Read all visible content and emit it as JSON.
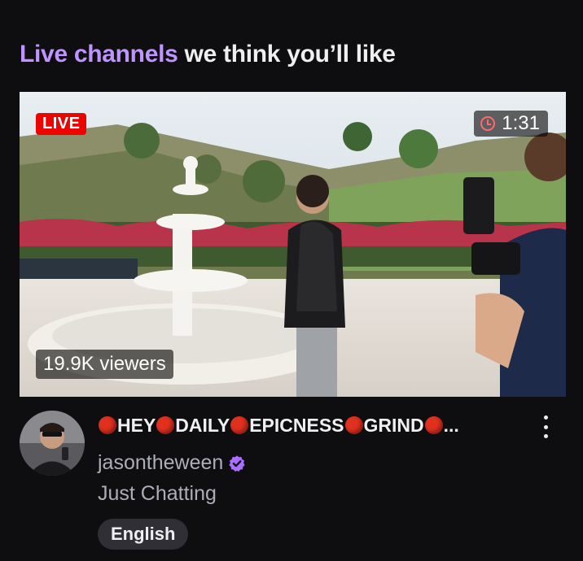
{
  "section": {
    "title_accent": "Live channels",
    "title_rest": " we think you’ll like"
  },
  "stream": {
    "live_label": "LIVE",
    "uptime": "1:31",
    "viewers": "19.9K viewers",
    "title_segments": [
      "HEY",
      "DAILY",
      "EPICNESS",
      "GRIND",
      "..."
    ],
    "channel": "jasontheween",
    "category": "Just Chatting",
    "tag": "English"
  },
  "icons": {
    "clock": "clock-icon",
    "verified": "verified-badge-icon",
    "more": "more-options-icon",
    "red_dot": "red-circle-emoji-icon"
  },
  "colors": {
    "background": "#0e0e10",
    "accent": "#bf94ff",
    "live": "#eb0400",
    "muted_text": "#adadb8",
    "tag_bg": "#2f2f35",
    "verified": "#a970ff"
  }
}
